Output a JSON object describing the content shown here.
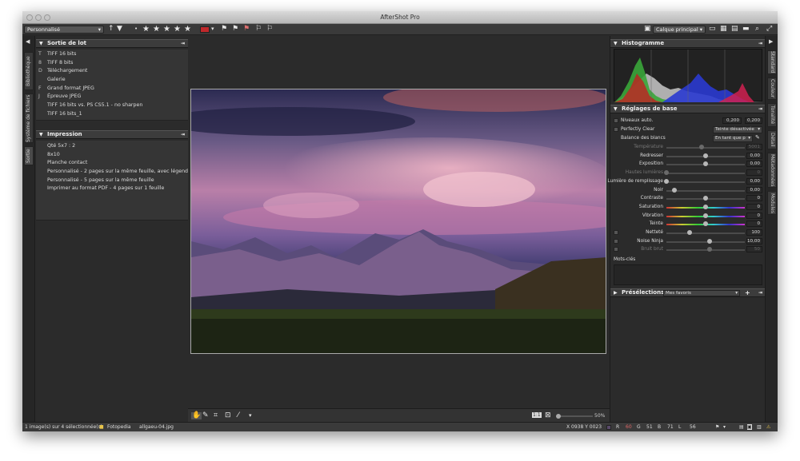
{
  "window": {
    "title": "AfterShot Pro"
  },
  "toolbar": {
    "preset": "Personnalisé",
    "layer": "Calque principal",
    "stars": [
      "★",
      "★",
      "★",
      "★",
      "★"
    ],
    "dot": "•"
  },
  "left_tabs": [
    "Bibliothèque",
    "Système de fichiers",
    "Sortie"
  ],
  "right_tabs": [
    "Standard",
    "Couleur",
    "Tonalité",
    "Détail",
    "Métadonnées",
    "Modules"
  ],
  "batch": {
    "title": "Sortie de lot",
    "items": [
      {
        "key": "T",
        "label": "TIFF 16 bits"
      },
      {
        "key": "8",
        "label": "TIFF 8 bits"
      },
      {
        "key": "D",
        "label": "Téléchargement"
      },
      {
        "key": "",
        "label": "Galerie"
      },
      {
        "key": "F",
        "label": "Grand format JPEG"
      },
      {
        "key": "J",
        "label": "Épreuve JPEG"
      },
      {
        "key": "",
        "label": "TIFF 16 bits vs. PS CS5.1 - no sharpen"
      },
      {
        "key": "",
        "label": "TIFF 16 bits_1"
      }
    ]
  },
  "print": {
    "title": "Impression",
    "items": [
      "Qté 5x7 : 2",
      "8x10",
      "Planche contact",
      "Personnalisé - 2 pages sur la même feuille, avec légendes",
      "Personnalisé - 5 pages sur la même feuille",
      "Imprimer au format PDF - 4 pages sur 1 feuille"
    ]
  },
  "histogram": {
    "title": "Histogramme"
  },
  "basic": {
    "title": "Réglages de base",
    "auto_levels": {
      "label": "Niveaux auto.",
      "v1": "0,200",
      "v2": "0,200"
    },
    "perfectly_clear": {
      "label": "Perfectly Clear",
      "value": "Teinte désactivée"
    },
    "white_balance": {
      "label": "Balance des blancs",
      "value": "En tant que p"
    },
    "sliders": [
      {
        "name": "temperature",
        "label": "Température",
        "value": "5001",
        "pos": 0.45,
        "enabled": false
      },
      {
        "name": "straighten",
        "label": "Redresser",
        "value": "0,00",
        "pos": 0.5,
        "enabled": true
      },
      {
        "name": "exposure",
        "label": "Exposition",
        "value": "0,00",
        "pos": 0.5,
        "enabled": true
      },
      {
        "name": "highlights",
        "label": "Hautes lumières",
        "value": "0",
        "pos": 0.0,
        "enabled": false
      },
      {
        "name": "fill-light",
        "label": "Lumière de remplissage",
        "value": "0,00",
        "pos": 0.0,
        "enabled": true
      },
      {
        "name": "black",
        "label": "Noir",
        "value": "0,00",
        "pos": 0.1,
        "enabled": true
      },
      {
        "name": "contrast",
        "label": "Contraste",
        "value": "0",
        "pos": 0.5,
        "enabled": true
      },
      {
        "name": "saturation",
        "label": "Saturation",
        "value": "0",
        "pos": 0.5,
        "enabled": true
      },
      {
        "name": "vibrance",
        "label": "Vibration",
        "value": "0",
        "pos": 0.5,
        "enabled": true
      },
      {
        "name": "tint",
        "label": "Teinte",
        "value": "0",
        "pos": 0.5,
        "enabled": true
      },
      {
        "name": "sharpness",
        "label": "Netteté",
        "value": "100",
        "pos": 0.3,
        "enabled": true
      },
      {
        "name": "noise-ninja",
        "label": "Noise Ninja",
        "value": "10,00",
        "pos": 0.55,
        "enabled": true
      },
      {
        "name": "raw-noise",
        "label": "Bruit brut",
        "value": "50",
        "pos": 0.55,
        "enabled": false
      }
    ],
    "keywords": "Mots-clés"
  },
  "presets": {
    "title": "Présélections",
    "value": "Mes favoris"
  },
  "bottom": {
    "zoom": "50%",
    "fit1": "1:1"
  },
  "status": {
    "selection": "1 image(s) sur 4 sélectionnée(s)",
    "folder": "Fotopedia",
    "file": "allgaeu-04.jpg",
    "coords": "X 0938  Y 0023",
    "r_label": "R",
    "r": "60",
    "g_label": "G",
    "g": "51",
    "b_label": "B",
    "b": "71",
    "l_label": "L",
    "l": "56"
  },
  "colors": {
    "accent_red": "#c0282b",
    "panel_bg": "#2b2b2b"
  }
}
